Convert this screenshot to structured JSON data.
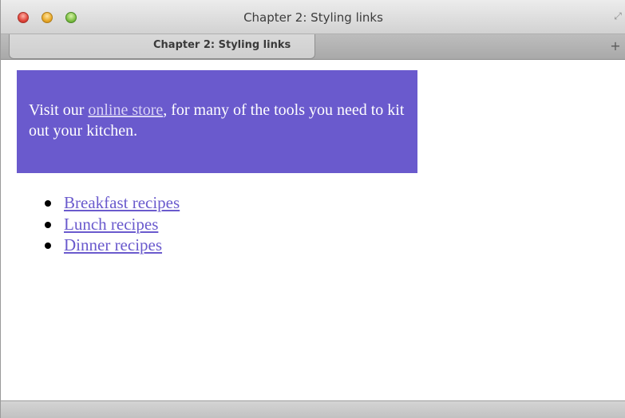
{
  "window": {
    "title": "Chapter 2: Styling links"
  },
  "tabs": [
    {
      "label": "Chapter 2: Styling links",
      "active": true
    }
  ],
  "icons": {
    "close": "close-icon",
    "minimize": "minimize-icon",
    "zoom": "zoom-icon",
    "fullscreen": "fullscreen-icon",
    "new_tab": "plus-icon"
  },
  "promo": {
    "text_before": "Visit our ",
    "link_text": "online store",
    "text_after": ", for many of the tools you need to kit out your kitchen.",
    "background": "#6a5acd"
  },
  "recipes": [
    {
      "label": "Breakfast recipes"
    },
    {
      "label": "Lunch recipes"
    },
    {
      "label": "Dinner recipes"
    }
  ],
  "colors": {
    "accent": "#6a5acd",
    "link_on_accent": "#d9d3f5"
  }
}
